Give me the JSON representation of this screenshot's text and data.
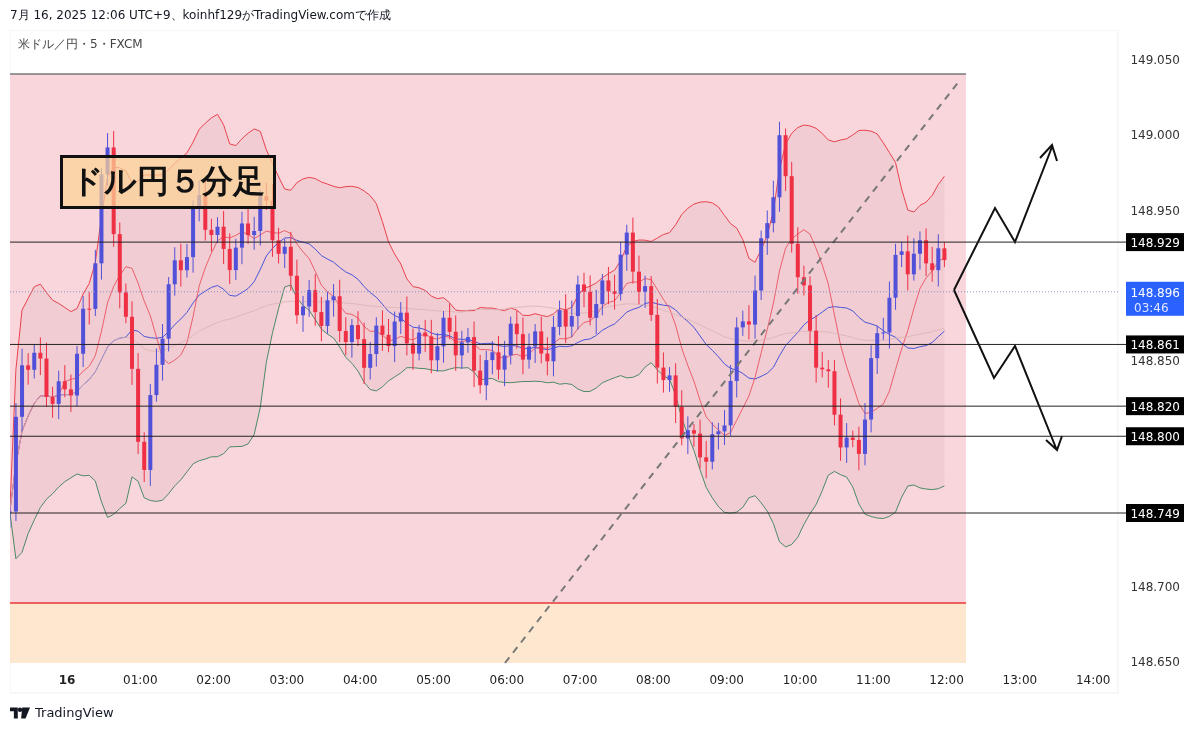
{
  "header": {
    "caption": "7月 16, 2025 12:06 UTC+9、koinhf129がTradingView.comで作成"
  },
  "chart": {
    "symbol": "米ドル／円・5・FXCM",
    "annotation": "ドル円５分足",
    "price_ticks": [
      "149.050",
      "149.000",
      "148.950",
      "148.850",
      "148.700",
      "148.650"
    ],
    "level_tags": [
      "148.929",
      "148.861",
      "148.820",
      "148.800",
      "148.749"
    ],
    "current_price": {
      "price": "148.896",
      "countdown": "03:46"
    },
    "time_ticks": [
      {
        "label": "16",
        "bold": true
      },
      {
        "label": "01:00",
        "bold": false
      },
      {
        "label": "02:00",
        "bold": false
      },
      {
        "label": "03:00",
        "bold": false
      },
      {
        "label": "04:00",
        "bold": false
      },
      {
        "label": "05:00",
        "bold": false
      },
      {
        "label": "06:00",
        "bold": false
      },
      {
        "label": "07:00",
        "bold": false
      },
      {
        "label": "08:00",
        "bold": false
      },
      {
        "label": "09:00",
        "bold": false
      },
      {
        "label": "10:00",
        "bold": false
      },
      {
        "label": "11:00",
        "bold": false
      },
      {
        "label": "12:00",
        "bold": false
      },
      {
        "label": "13:00",
        "bold": false
      },
      {
        "label": "14:00",
        "bold": false
      }
    ]
  },
  "footer": {
    "brand": "TradingView"
  }
}
